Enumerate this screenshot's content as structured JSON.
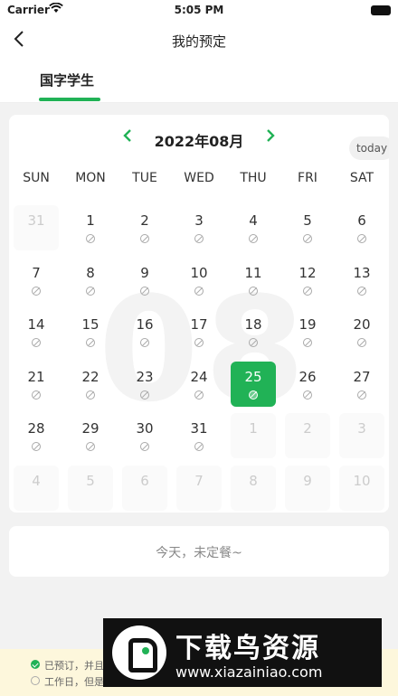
{
  "status_bar": {
    "carrier": "Carrier",
    "time": "5:05 PM"
  },
  "nav": {
    "back_icon": "chevron-left",
    "title": "我的预定"
  },
  "tabs": [
    {
      "label": "国字学生",
      "active": true
    }
  ],
  "calendar": {
    "month_label": "2022年08月",
    "watermark": "08",
    "today_label": "today",
    "weekdays": [
      "SUN",
      "MON",
      "TUE",
      "WED",
      "THU",
      "FRI",
      "SAT"
    ],
    "selected_day": "25",
    "weeks": [
      [
        {
          "d": "31",
          "cur": false,
          "mark": false
        },
        {
          "d": "1",
          "cur": true,
          "mark": true
        },
        {
          "d": "2",
          "cur": true,
          "mark": true
        },
        {
          "d": "3",
          "cur": true,
          "mark": true
        },
        {
          "d": "4",
          "cur": true,
          "mark": true
        },
        {
          "d": "5",
          "cur": true,
          "mark": true
        },
        {
          "d": "6",
          "cur": true,
          "mark": true
        }
      ],
      [
        {
          "d": "7",
          "cur": true,
          "mark": true
        },
        {
          "d": "8",
          "cur": true,
          "mark": true
        },
        {
          "d": "9",
          "cur": true,
          "mark": true
        },
        {
          "d": "10",
          "cur": true,
          "mark": true
        },
        {
          "d": "11",
          "cur": true,
          "mark": true
        },
        {
          "d": "12",
          "cur": true,
          "mark": true
        },
        {
          "d": "13",
          "cur": true,
          "mark": true
        }
      ],
      [
        {
          "d": "14",
          "cur": true,
          "mark": true
        },
        {
          "d": "15",
          "cur": true,
          "mark": true
        },
        {
          "d": "16",
          "cur": true,
          "mark": true
        },
        {
          "d": "17",
          "cur": true,
          "mark": true
        },
        {
          "d": "18",
          "cur": true,
          "mark": true
        },
        {
          "d": "19",
          "cur": true,
          "mark": true
        },
        {
          "d": "20",
          "cur": true,
          "mark": true
        }
      ],
      [
        {
          "d": "21",
          "cur": true,
          "mark": true
        },
        {
          "d": "22",
          "cur": true,
          "mark": true
        },
        {
          "d": "23",
          "cur": true,
          "mark": true
        },
        {
          "d": "24",
          "cur": true,
          "mark": true
        },
        {
          "d": "25",
          "cur": true,
          "mark": true
        },
        {
          "d": "26",
          "cur": true,
          "mark": true
        },
        {
          "d": "27",
          "cur": true,
          "mark": true
        }
      ],
      [
        {
          "d": "28",
          "cur": true,
          "mark": true
        },
        {
          "d": "29",
          "cur": true,
          "mark": true
        },
        {
          "d": "30",
          "cur": true,
          "mark": true
        },
        {
          "d": "31",
          "cur": true,
          "mark": true
        },
        {
          "d": "1",
          "cur": false,
          "mark": false
        },
        {
          "d": "2",
          "cur": false,
          "mark": false
        },
        {
          "d": "3",
          "cur": false,
          "mark": false
        }
      ],
      [
        {
          "d": "4",
          "cur": false,
          "mark": false
        },
        {
          "d": "5",
          "cur": false,
          "mark": false
        },
        {
          "d": "6",
          "cur": false,
          "mark": false
        },
        {
          "d": "7",
          "cur": false,
          "mark": false
        },
        {
          "d": "8",
          "cur": false,
          "mark": false
        },
        {
          "d": "9",
          "cur": false,
          "mark": false
        },
        {
          "d": "10",
          "cur": false,
          "mark": false
        }
      ]
    ]
  },
  "meal_status": "今天，未定餐~",
  "legend": [
    {
      "icon": "check-circle-icon",
      "text": "已预订，并且"
    },
    {
      "icon": "no-booking-icon",
      "text": "工作日，但是"
    }
  ],
  "promo": {
    "name": "下载鸟资源",
    "url": "www.xiazainiao.com"
  },
  "colors": {
    "accent": "#21b256",
    "legend_bg": "#fdf7dc"
  }
}
